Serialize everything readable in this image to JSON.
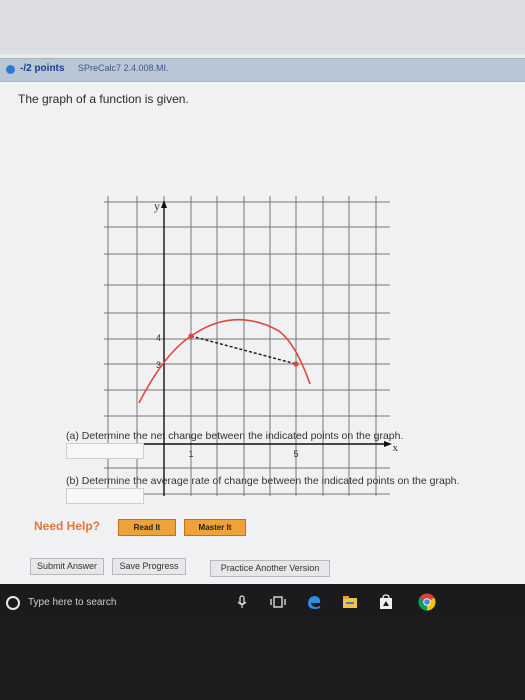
{
  "question": {
    "points": "-/2 points",
    "code": "SPreCalc7 2.4.008.MI.",
    "prompt": "The graph of a function is given."
  },
  "graph": {
    "y_label": "y",
    "x_label": "x",
    "tick_labels": {
      "y4": "4",
      "y3": "3",
      "x1": "1",
      "x5": "5"
    },
    "curve_color": "#e0473a",
    "points": [
      {
        "x": 1,
        "y": 4
      },
      {
        "x": 5,
        "y": 3
      }
    ]
  },
  "parts": {
    "a": "(a) Determine the net change between the indicated points on the graph.",
    "b": "(b) Determine the average rate of change between the indicated points on the graph."
  },
  "help": {
    "title": "Need Help?",
    "read_it": "Read It",
    "master_it": "Master It"
  },
  "actions": {
    "submit": "Submit Answer",
    "save": "Save Progress",
    "practice": "Practice Another Version"
  },
  "taskbar": {
    "search_placeholder": "Type here to search",
    "icons": [
      "microphone-icon",
      "task-view-icon",
      "edge-icon",
      "file-explorer-icon",
      "store-icon",
      "chrome-icon"
    ]
  }
}
